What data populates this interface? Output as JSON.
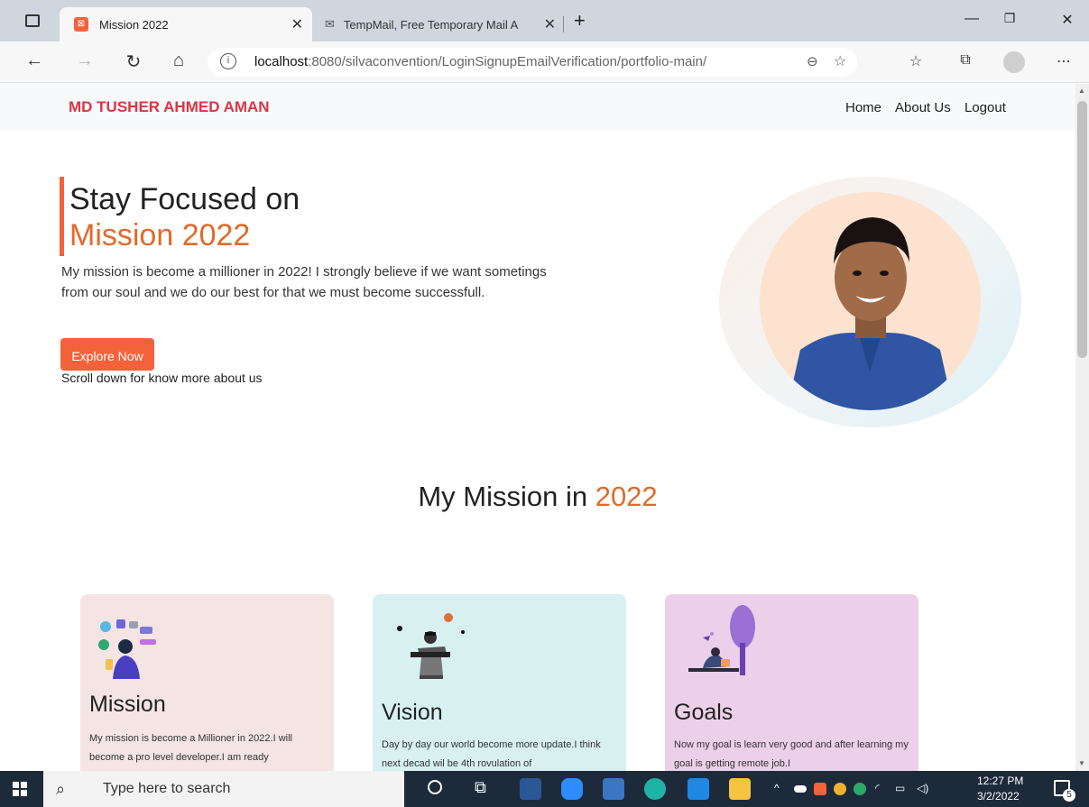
{
  "browser": {
    "tabs": [
      {
        "title": "Mission 2022",
        "active": true
      },
      {
        "title": "TempMail, Free Temporary Mail A",
        "active": false
      }
    ],
    "url_host": "localhost",
    "url_rest": ":8080/silvaconvention/LoginSignupEmailVerification/portfolio-main/"
  },
  "site": {
    "brand": "MD TUSHER AHMED AMAN",
    "nav": [
      "Home",
      "About Us",
      "Logout"
    ]
  },
  "hero": {
    "title_line1": "Stay Focused on",
    "title_line2": "Mission 2022",
    "paragraph": "My mission is become a millioner in 2022! I strongly believe if we want sometings from our soul and we do our best for that we must become successfull.",
    "button": "Explore Now",
    "scroll_note": "Scroll down for know more about us"
  },
  "section": {
    "title_main": "My Mission in",
    "title_accent": "2022"
  },
  "cards": [
    {
      "title": "Mission",
      "text": "My mission is become a Millioner in 2022.I will become a pro level developer.I am ready",
      "bg": "#f4e4e4"
    },
    {
      "title": "Vision",
      "text": "Day by day our world become more update.I think next decad wil be 4th rovulation of",
      "bg": "#d8f0f0"
    },
    {
      "title": "Goals",
      "text": "Now my goal is learn very good and after learning my goal is getting remote job.I",
      "bg": "#eccfe9"
    }
  ],
  "taskbar": {
    "search_placeholder": "Type here to search",
    "time": "12:27 PM",
    "date": "3/2/2022",
    "notification_count": "5"
  },
  "colors": {
    "accent": "#f4623a",
    "brand": "#dc3545",
    "orange_text": "#e06a2b"
  }
}
